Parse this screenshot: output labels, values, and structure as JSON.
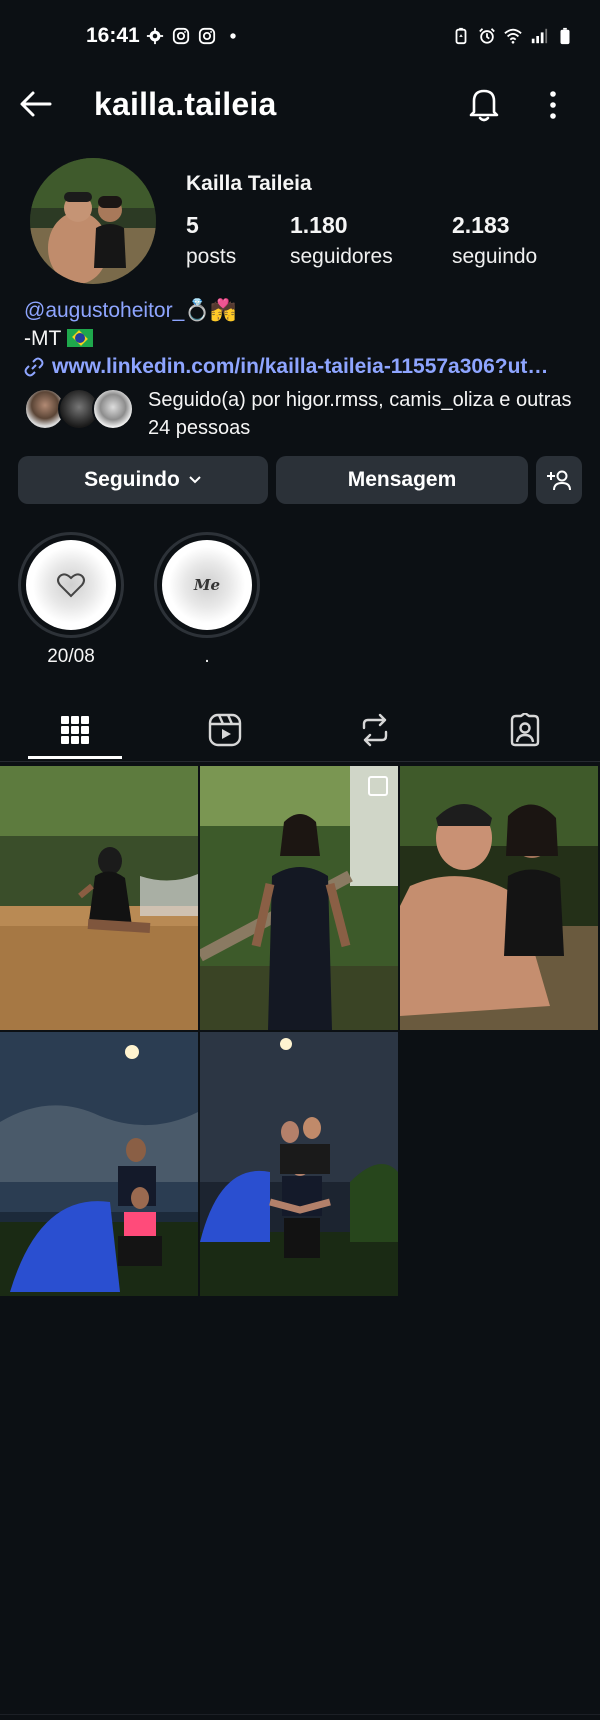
{
  "status_bar": {
    "time": "16:41",
    "left_icons": [
      "settings-gear-icon",
      "instagram-icon",
      "instagram-icon",
      "dot-icon"
    ],
    "right_icons": [
      "battery-saver-icon",
      "alarm-icon",
      "wifi-icon",
      "signal-icon",
      "battery-icon"
    ]
  },
  "header": {
    "username": "kailla.taileia",
    "back_icon": "back-arrow-icon",
    "notifications_icon": "bell-icon",
    "more_icon": "more-vertical-icon"
  },
  "profile": {
    "display_name": "Kailla Taileia",
    "stats": [
      {
        "value": "5",
        "label": "posts"
      },
      {
        "value": "1.180",
        "label": "seguidores"
      },
      {
        "value": "2.183",
        "label": "seguindo"
      }
    ],
    "bio_mention": "@augustoheitor_💍💏",
    "bio_line2": "-MT",
    "bio_link": "www.linkedin.com/in/kailla-taileia-11557a306?ut…",
    "followed_by": "Seguido(a) por higor.rmss, camis_oliza e outras 24 pessoas"
  },
  "actions": {
    "following_label": "Seguindo",
    "message_label": "Mensagem",
    "add_person_icon": "add-person-icon"
  },
  "highlights": [
    {
      "label": "20/08",
      "icon": "heart-icon"
    },
    {
      "label": ".",
      "icon": "me-text-icon",
      "text": "Me"
    }
  ],
  "tabs": [
    {
      "name": "grid",
      "icon": "grid-icon",
      "active": true
    },
    {
      "name": "reels",
      "icon": "reels-icon",
      "active": false
    },
    {
      "name": "reposts",
      "icon": "repost-icon",
      "active": false
    },
    {
      "name": "tagged",
      "icon": "tagged-user-icon",
      "active": false
    }
  ],
  "posts_count": 5
}
